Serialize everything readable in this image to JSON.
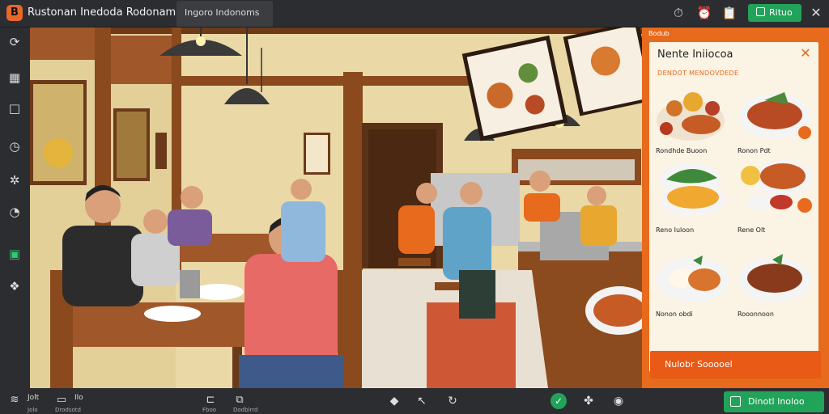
{
  "app": {
    "title": "Rustonan Inedoda Rodonami",
    "tab": "Ingoro Indonoms",
    "primary_button": "Rituo",
    "icons": {
      "logo": "app-logo-icon",
      "toolbar": [
        "timer-icon",
        "alarm-icon",
        "clipboard-icon"
      ],
      "close": "close-icon"
    }
  },
  "sidebar": {
    "items": [
      {
        "name": "lasso-icon"
      },
      {
        "name": "image-icon"
      },
      {
        "name": "frame-icon"
      },
      {
        "name": "history-icon"
      },
      {
        "name": "network-icon"
      },
      {
        "name": "gauge-icon"
      },
      {
        "name": "book-icon",
        "active": true
      },
      {
        "name": "settings-icon"
      }
    ]
  },
  "panel": {
    "header": "Bodub",
    "title": "Nente Iniiocoa",
    "subtitle": "DENDOT MENDOVDEDE",
    "items": [
      {
        "label": "Rondhde Buoon",
        "dish": "curry"
      },
      {
        "label": "Ronon Pdt",
        "dish": "satay"
      },
      {
        "label": "",
        "dish": "noodles"
      },
      {
        "label": "",
        "dish": "fried"
      },
      {
        "label": "Reno Iuloon",
        "dish": ""
      },
      {
        "label": "Rene Olt",
        "dish": ""
      },
      {
        "label": "Nonon obdi",
        "dish": "rice"
      },
      {
        "label": "Rooonnoon",
        "dish": "rendang"
      }
    ],
    "order_button": "Nulobr Sooooel"
  },
  "bottombar": {
    "left": [
      {
        "icon": "layers-icon",
        "label": "Jolt",
        "sub": "Jolo"
      },
      {
        "icon": "frame-icon",
        "label": "Ilo",
        "sub": "Drodsotd"
      }
    ],
    "middle": [
      {
        "icon": "file-icon",
        "sub": "Fboo"
      },
      {
        "icon": "folder-icon",
        "sub": "Dodblrrd"
      }
    ],
    "tools": [
      "eraser-icon",
      "pointer-icon",
      "refresh-icon"
    ],
    "status": [
      "check-icon",
      "puzzle-icon",
      "record-icon"
    ],
    "primary": "Dinotl Inoloo",
    "colors": {
      "accent": "#22a35a",
      "panel": "#e86a1c"
    }
  }
}
